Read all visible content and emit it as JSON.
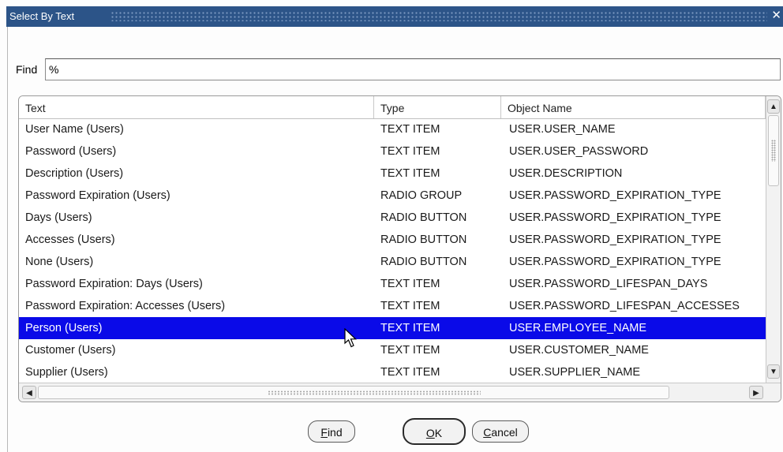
{
  "window": {
    "title": "Select By Text",
    "close_glyph": "✕"
  },
  "find": {
    "label": "Find",
    "value": "%"
  },
  "table": {
    "columns": [
      "Text",
      "Type",
      "Object Name"
    ],
    "selected_index": 9,
    "rows": [
      [
        "User Name (Users)",
        "TEXT ITEM",
        "USER.USER_NAME"
      ],
      [
        "Password (Users)",
        "TEXT ITEM",
        "USER.USER_PASSWORD"
      ],
      [
        "Description (Users)",
        "TEXT ITEM",
        "USER.DESCRIPTION"
      ],
      [
        "Password Expiration (Users)",
        "RADIO GROUP",
        "USER.PASSWORD_EXPIRATION_TYPE"
      ],
      [
        "Days (Users)",
        "RADIO BUTTON",
        "USER.PASSWORD_EXPIRATION_TYPE"
      ],
      [
        "Accesses (Users)",
        "RADIO BUTTON",
        "USER.PASSWORD_EXPIRATION_TYPE"
      ],
      [
        "None (Users)",
        "RADIO BUTTON",
        "USER.PASSWORD_EXPIRATION_TYPE"
      ],
      [
        "Password Expiration: Days (Users)",
        "TEXT ITEM",
        "USER.PASSWORD_LIFESPAN_DAYS"
      ],
      [
        "Password Expiration: Accesses (Users)",
        "TEXT ITEM",
        "USER.PASSWORD_LIFESPAN_ACCESSES"
      ],
      [
        "Person (Users)",
        "TEXT ITEM",
        "USER.EMPLOYEE_NAME"
      ],
      [
        "Customer (Users)",
        "TEXT ITEM",
        "USER.CUSTOMER_NAME"
      ],
      [
        "Supplier (Users)",
        "TEXT ITEM",
        "USER.SUPPLIER_NAME"
      ]
    ]
  },
  "buttons": {
    "find": {
      "mnemonic": "F",
      "rest": "ind"
    },
    "ok": {
      "mnemonic": "O",
      "rest": "K"
    },
    "cancel": {
      "mnemonic": "C",
      "rest": "ancel"
    }
  },
  "scrollbar_glyphs": {
    "up": "▲",
    "down": "▼",
    "left": "◀",
    "right": "▶"
  },
  "colors": {
    "titlebar": "#2c5488",
    "selection": "#0a0ae8"
  }
}
